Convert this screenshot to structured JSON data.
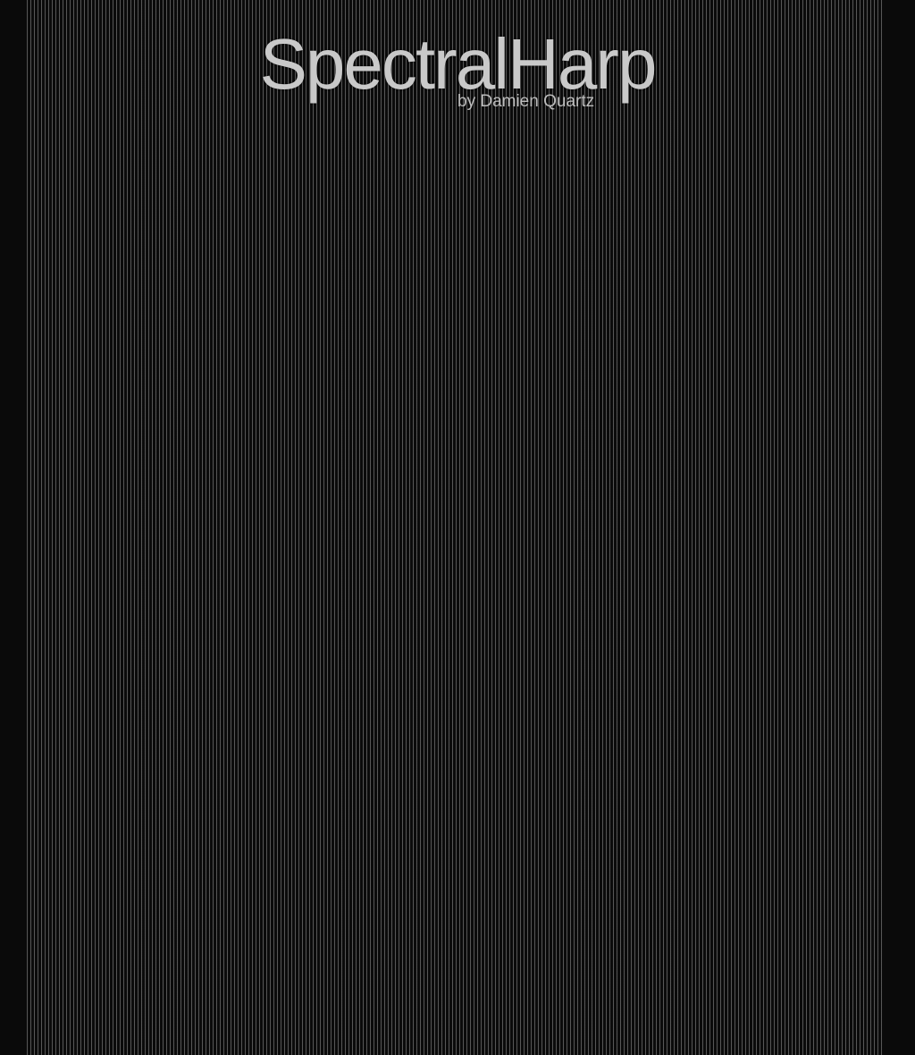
{
  "header": {
    "title": "SpectralHarp",
    "byline": "by Damien Quartz"
  },
  "harp": {
    "description_color": "#969696",
    "background_color": "#0b0b0b"
  }
}
